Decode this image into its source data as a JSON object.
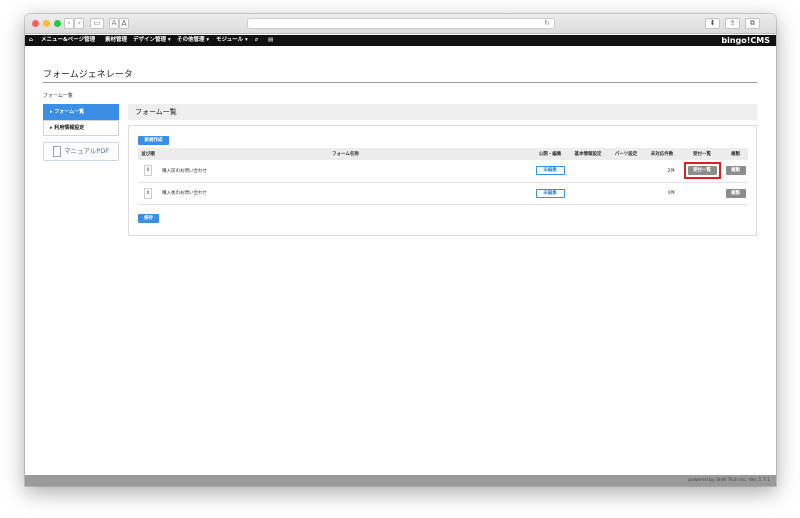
{
  "browser": {
    "nav_back": "‹",
    "nav_forward": "›",
    "font_small": "A",
    "font_large": "A",
    "reload_glyph": "↻",
    "download_glyph": "⬇",
    "share_glyph": "⇪",
    "tabs_glyph": "⧉"
  },
  "navbar": {
    "items": [
      "メニュー&ページ管理",
      "素材管理",
      "デザイン管理 ▾",
      "その他管理 ▾",
      "モジュール ▾"
    ],
    "brand": "bingo!CMS"
  },
  "page": {
    "title": "フォームジェネレータ",
    "breadcrumb": "フォーム一覧"
  },
  "sidebar": {
    "items": [
      {
        "label": "▸ フォーム一覧"
      },
      {
        "label": "▸ 利用情報設定"
      }
    ],
    "pdf_label": "マニュアルPDF"
  },
  "panel": {
    "heading": "フォーム一覧",
    "new_button": "新規作成",
    "save_button": "保存",
    "columns": [
      "並び順",
      "フォーム名称",
      "公開・編集",
      "基本情報設定",
      "パーツ設定",
      "未対応件数",
      "受付一覧",
      "複製"
    ],
    "rows": [
      {
        "order": "0",
        "name": "購入前のお問い合わせ",
        "edit": "未編集",
        "count": "2件",
        "reception": "受付一覧",
        "copy": "複製"
      },
      {
        "order": "0",
        "name": "購入後のお問い合わせ",
        "edit": "未編集",
        "count": "0件",
        "reception": "",
        "copy": "複製"
      }
    ]
  },
  "footer": {
    "text": "powered by Shift Tech Inc. Ver. 1.7.1"
  },
  "colors": {
    "accent": "#3a8ee6",
    "highlight": "#e02020"
  }
}
